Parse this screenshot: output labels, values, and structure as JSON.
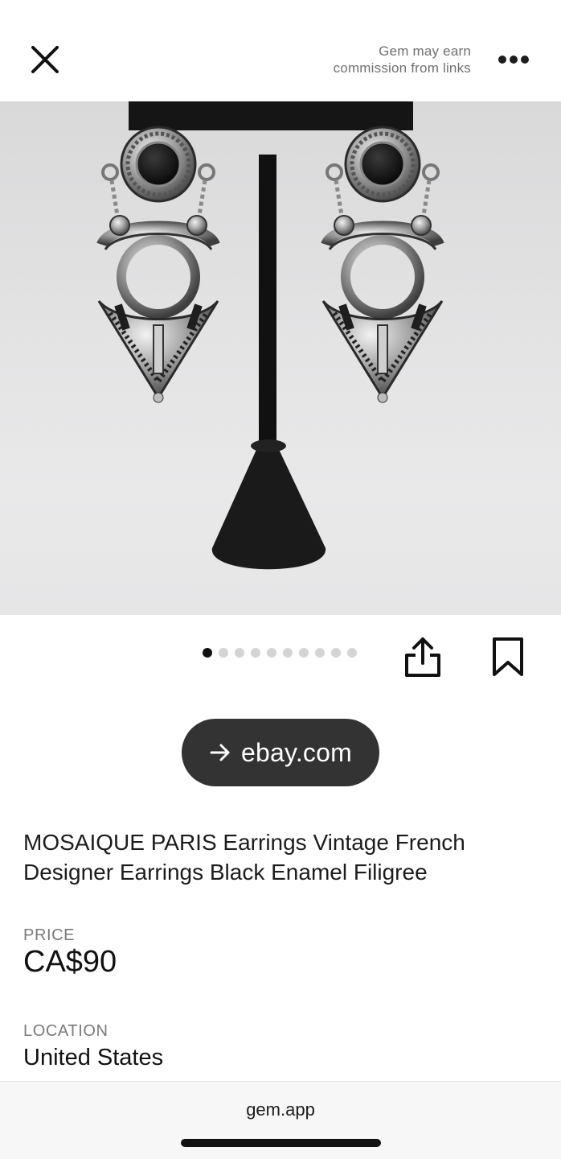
{
  "header": {
    "close_icon": "close-icon",
    "commission_line1": "Gem may earn",
    "commission_line2": "commission from links",
    "more_icon": "more-horizontal-icon"
  },
  "carousel": {
    "image": "silver-drop-earrings-with-black-enamel-on-black-stand",
    "total_images": 10,
    "active_index": 0
  },
  "actions": {
    "share_icon": "share-icon",
    "bookmark_icon": "bookmark-icon"
  },
  "source": {
    "label": "ebay.com",
    "icon": "arrow-right-icon"
  },
  "listing": {
    "title": "MOSAIQUE PARIS Earrings Vintage French Designer Earrings Black Enamel Filigree",
    "price_label": "PRICE",
    "price": "CA$90",
    "location_label": "LOCATION",
    "location": "United States"
  },
  "browser": {
    "url": "gem.app"
  }
}
